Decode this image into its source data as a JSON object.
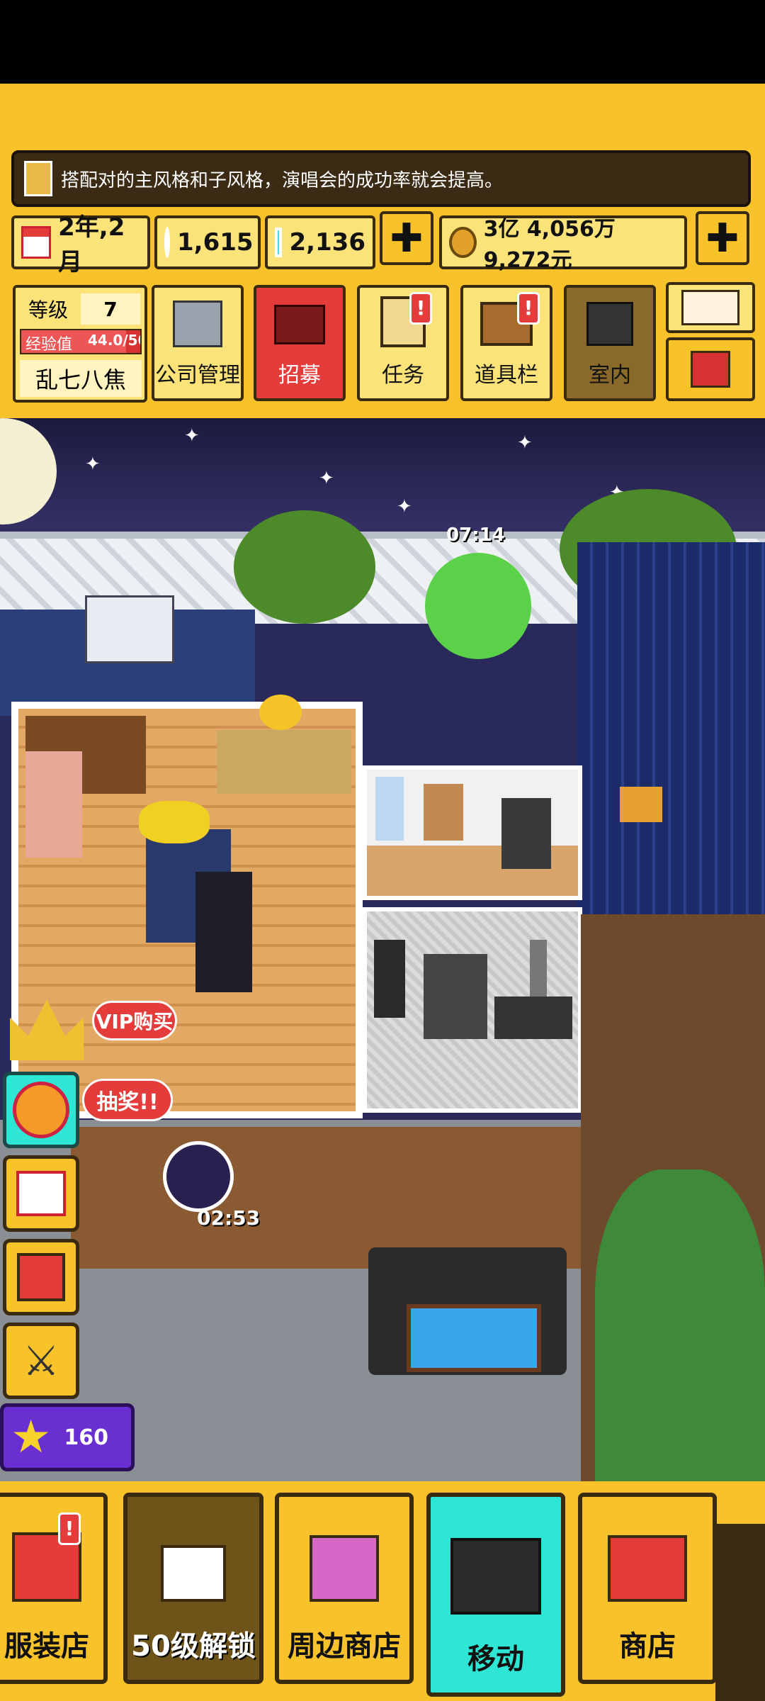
{
  "tip": {
    "text": "搭配对的主风格和子风格，演唱会的成功率就会提高。"
  },
  "stats": {
    "date": "2年,2月",
    "gems": "1,615",
    "diamonds": "2,136",
    "money": "3亿 4,056万 9,272元"
  },
  "level": {
    "label": "等级",
    "value": "7",
    "exp_label": "经验值",
    "exp_value": "44.0/50",
    "exp_progress": 0.88,
    "company_name": "乱七八焦"
  },
  "menu": {
    "company": "公司管理",
    "recruit": "招募",
    "tasks": "任务",
    "items": "道具栏",
    "interior": "室内"
  },
  "scene": {
    "clock": "07:14",
    "timer": "02:53",
    "vip_label": "VIP购买",
    "lottery_label": "抽奖!!",
    "stars_count": "160"
  },
  "bottom": {
    "clothing": "服装店",
    "unlock": "50级解锁",
    "merch": "周边商店",
    "move": "移动",
    "shop": "商店"
  },
  "colors": {
    "accent": "#f7c22a",
    "recruit_red": "#e43b3b",
    "move_cyan": "#2ee6d3",
    "night_sky": "#2a2a5a"
  }
}
